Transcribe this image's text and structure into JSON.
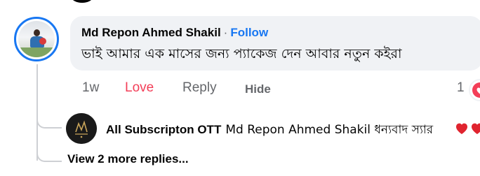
{
  "comment": {
    "author": "Md Repon Ahmed Shakil",
    "separator": "·",
    "follow_label": "Follow",
    "text": "ভাই আমার এক মাসের জন্য প্যাকেজ দেন আবার নতুন কইরা",
    "time": "1w",
    "love_label": "Love",
    "reply_label": "Reply",
    "hide_label": "Hide",
    "reaction_count": "1",
    "reaction_icon": "heart-icon",
    "avatar_icon": "profile-photo"
  },
  "reply": {
    "author": "All Subscripton OTT",
    "tagged_name": "Md Repon Ahmed Shakil",
    "text": "ধন্যবাদ স্যার",
    "emoji_icon": "red-heart-emoji",
    "avatar_icon": "page-logo"
  },
  "view_more_label": "View 2 more replies...",
  "colors": {
    "accent": "#1877f2",
    "love": "#f33e58",
    "bubble": "#f0f2f5",
    "secondary_text": "#65676b"
  }
}
